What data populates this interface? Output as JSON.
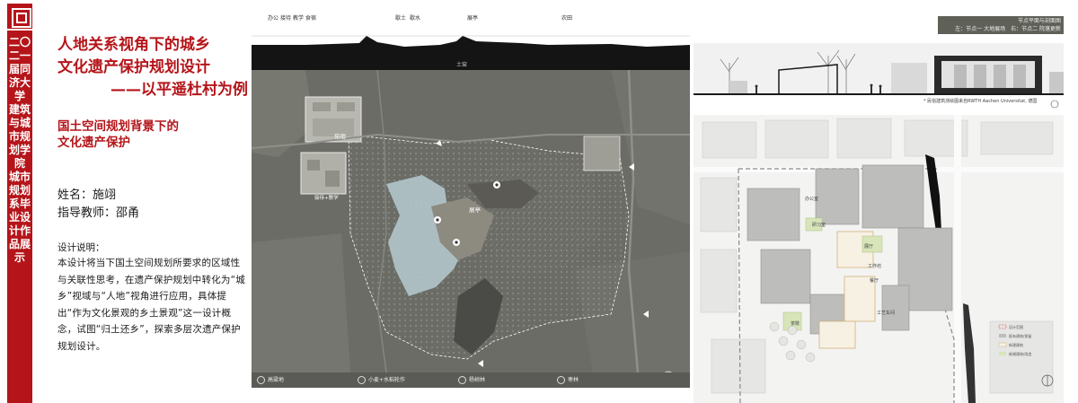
{
  "banner": {
    "vertical_text": "二〇二一届同济大学 建筑与城市规划学院 城市规划系毕业设计作品展示"
  },
  "poster": {
    "title_line1": "人地关系视角下的城乡",
    "title_line2": "文化遗产保护规划设计",
    "title_line3": "——以平遥杜村为例",
    "subtitle_line1": "国土空间规划背景下的",
    "subtitle_line2": "文化遗产保护",
    "student": "姓名：施翊",
    "advisor": "指导教师：邵甬",
    "desc_heading": "设计说明：",
    "description": "本设计将当下国土空间规划所要求的区域性与关联性思考，在遗产保护规划中转化为“城乡”视域与“人地”视角进行应用，具体提出“作为文化景观的乡土景观”这一设计概念，试图“归土还乡”，探索多层次遗产保护规划设计。"
  },
  "map": {
    "top_labels": [
      "办公",
      "接待",
      "教学",
      "食宿",
      "歇土",
      "歇水",
      "展亭",
      "农田",
      "土窑"
    ],
    "map_labels": [
      "窑宿",
      "接待+教学",
      "展亭"
    ],
    "legend": [
      "高粱地",
      "小麦+水稻轮作",
      "杨树林",
      "枣林"
    ]
  },
  "section": {
    "header_line1": "节点平面与剖面图",
    "header_line2": "左：节点一 大地展场　右：节点二 院落更新",
    "caption": "* 民俗建筑测绘图来自RWTH Aachen Universitat, 德国"
  },
  "plan": {
    "labels": [
      "办公室",
      "展厅",
      "研习室",
      "工作坊",
      "餐厅",
      "工艺车间",
      "茶歇"
    ],
    "legend": [
      "设计范围",
      "既有建筑/保留",
      "新建建筑",
      "新增建筑/改造"
    ]
  },
  "colors": {
    "accent": "#b5151a",
    "map_bg": "#6b6c66",
    "map_dark": "#1b1b1b"
  }
}
